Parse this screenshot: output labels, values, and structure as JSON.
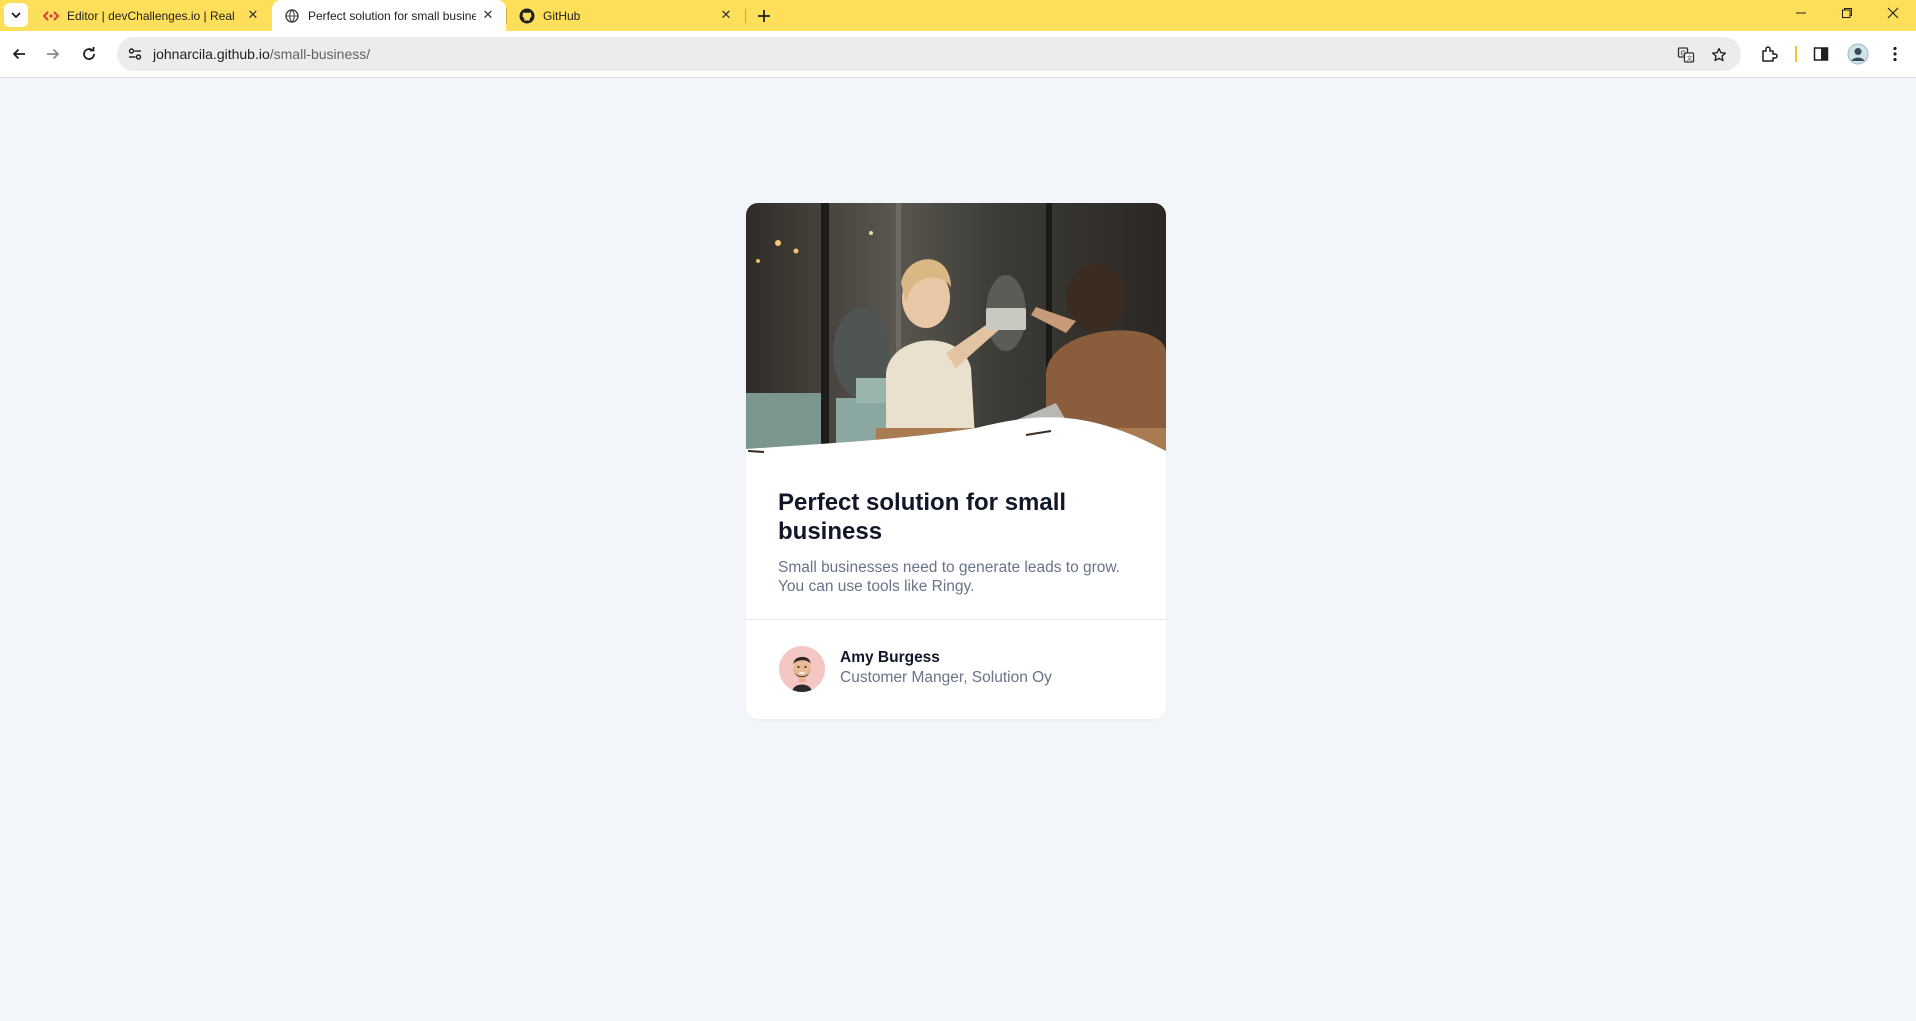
{
  "browser": {
    "tabs": [
      {
        "title": "Editor | devChallenges.io | Real-",
        "favicon": "code-brackets-icon",
        "active": false
      },
      {
        "title": "Perfect solution for small busine",
        "favicon": "globe-icon",
        "active": true
      },
      {
        "title": "GitHub",
        "favicon": "github-icon",
        "active": false
      }
    ],
    "address": {
      "host": "johnarcila.github.io",
      "path": "/small-business/"
    }
  },
  "card": {
    "title": "Perfect solution for small business",
    "description": "Small businesses need to generate leads to grow. You can use tools like Ringy.",
    "author": {
      "name": "Amy Burgess",
      "role": "Customer Manger, Solution Oy"
    }
  },
  "colors": {
    "tab_strip": "#fddf5a",
    "page_background": "#f2f5f9",
    "card_background": "#ffffff",
    "title_text": "#111729",
    "muted_text": "#677489",
    "avatar_background": "#f5c7c4"
  }
}
